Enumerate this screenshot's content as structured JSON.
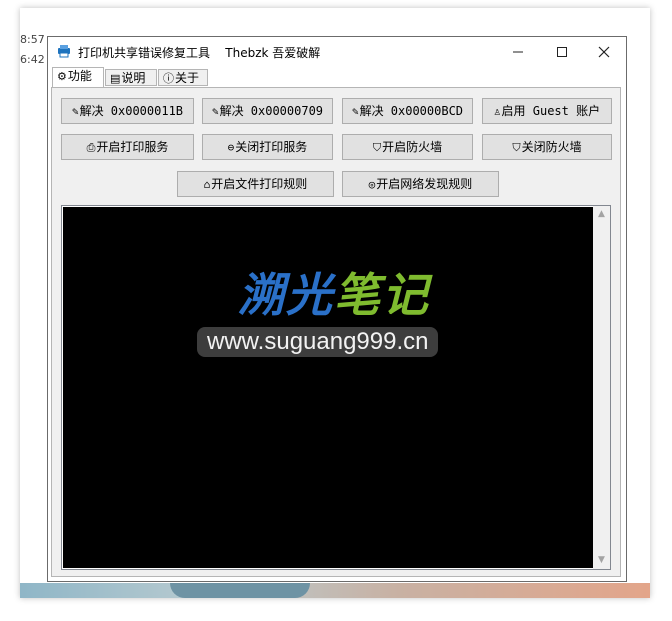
{
  "background": {
    "times": [
      "8:57",
      "6:42"
    ]
  },
  "window": {
    "title": "打印机共享错误修复工具    Thebzk 吾爱破解",
    "controls": {
      "minimize": "—",
      "maximize": "☐",
      "close": "✕"
    }
  },
  "tabs": [
    {
      "icon": "⚙",
      "label": "功能"
    },
    {
      "icon": "▤",
      "label": "说明"
    },
    {
      "icon": "ⓘ",
      "label": "关于"
    }
  ],
  "buttons": {
    "fix_11b": {
      "icon": "✎",
      "label": "解决 0x0000011B"
    },
    "fix_709": {
      "icon": "✎",
      "label": "解决 0x00000709"
    },
    "fix_bcd": {
      "icon": "✎",
      "label": "解决 0x00000BCD"
    },
    "enable_guest": {
      "icon": "♙",
      "label": "启用 Guest 账户"
    },
    "start_print": {
      "icon": "⎙",
      "label": "开启打印服务"
    },
    "stop_print": {
      "icon": "⊖",
      "label": "关闭打印服务"
    },
    "fw_on": {
      "icon": "⛉",
      "label": "开启防火墙"
    },
    "fw_off": {
      "icon": "⛉",
      "label": "关闭防火墙"
    },
    "file_rule": {
      "icon": "⌂",
      "label": "开启文件打印规则"
    },
    "net_rule": {
      "icon": "◎",
      "label": "开启网络发现规则"
    }
  },
  "watermark": {
    "logo_part1": "溯光",
    "logo_part2": "笔记",
    "url": "www.suguang999.cn"
  },
  "colors": {
    "logo_blue": "#2a70c8",
    "logo_green": "#7fbb2f",
    "console_bg": "#000000"
  }
}
